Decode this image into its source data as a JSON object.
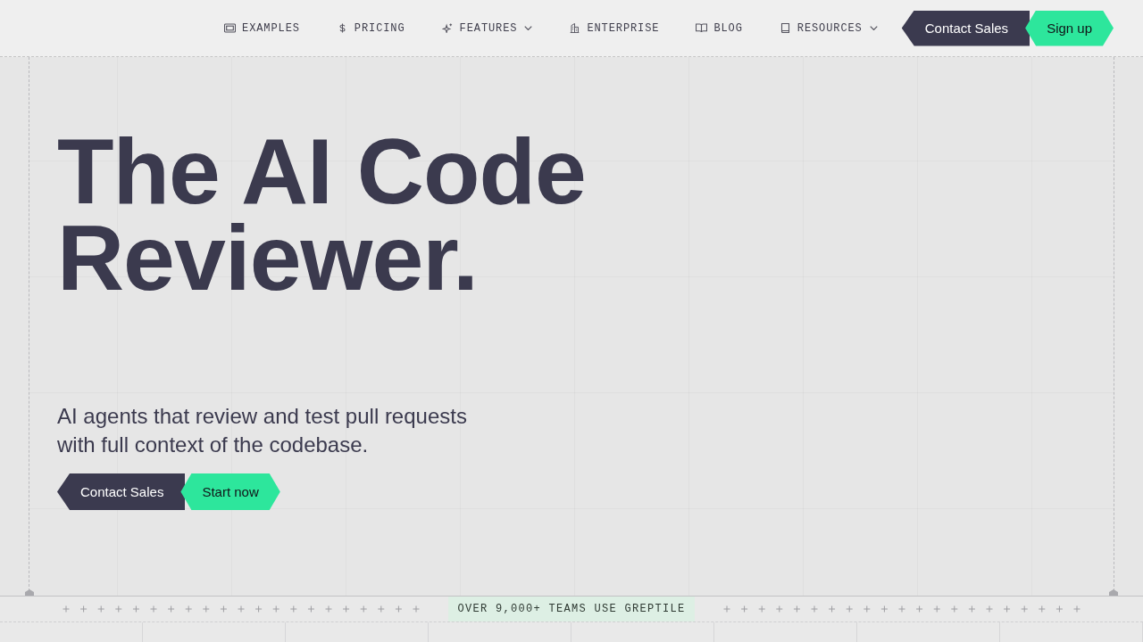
{
  "nav": {
    "items": [
      {
        "label": "EXAMPLES",
        "dropdown": false
      },
      {
        "label": "PRICING",
        "dropdown": false
      },
      {
        "label": "FEATURES",
        "dropdown": true
      },
      {
        "label": "ENTERPRISE",
        "dropdown": false
      },
      {
        "label": "BLOG",
        "dropdown": false
      },
      {
        "label": "RESOURCES",
        "dropdown": true
      }
    ],
    "buttons": [
      {
        "label": "Contact Sales",
        "kind": "secondary"
      },
      {
        "label": "Sign up",
        "kind": "primary"
      }
    ]
  },
  "hero": {
    "title": "The AI Code Reviewer.",
    "subtitle": "AI agents that review and test pull requests with full context of the codebase.",
    "buttons": [
      {
        "label": "Contact Sales",
        "kind": "secondary"
      },
      {
        "label": "Start now",
        "kind": "primary"
      }
    ]
  },
  "banner": {
    "text": "OVER 9,000+ TEAMS USE GREPTILE"
  }
}
